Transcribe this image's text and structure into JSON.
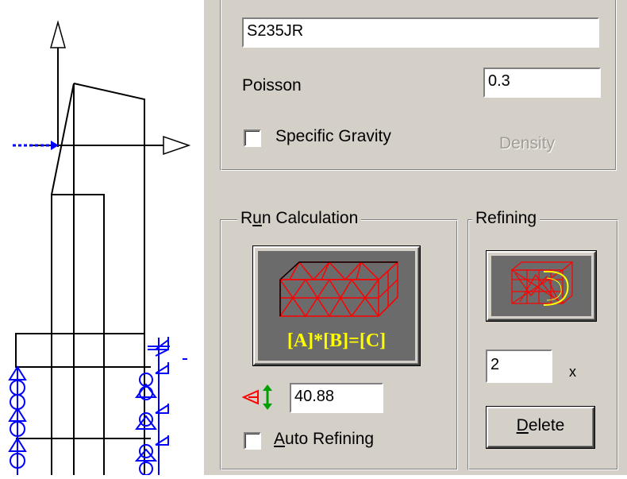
{
  "material": {
    "name_value": "S235JR",
    "poisson_label": "Poisson",
    "poisson_value": "0.3",
    "specific_gravity_label": "Specific Gravity",
    "specific_gravity_checked": false,
    "density_label": "Density"
  },
  "run_calculation": {
    "group_label": "Run Calculation",
    "button_formula": "[A]*[B]=[C]",
    "mesh_size_value": "40.88",
    "auto_refining_label": "Auto Refining",
    "auto_refining_checked": false
  },
  "refining": {
    "group_label": "Refining",
    "factor_value": "2",
    "factor_suffix": "x",
    "delete_label": "Delete"
  },
  "icons": [
    "axis-y-arrow-icon",
    "axis-x-arrow-icon",
    "support-symbol-icon",
    "mesh-size-icon",
    "mesh-calc-icon",
    "refine-mesh-icon"
  ],
  "colors": {
    "mesh_red": "#ff0000",
    "formula_yellow": "#ffff00",
    "support_blue": "#0000ff",
    "panel_gray": "#d4d0c8"
  }
}
